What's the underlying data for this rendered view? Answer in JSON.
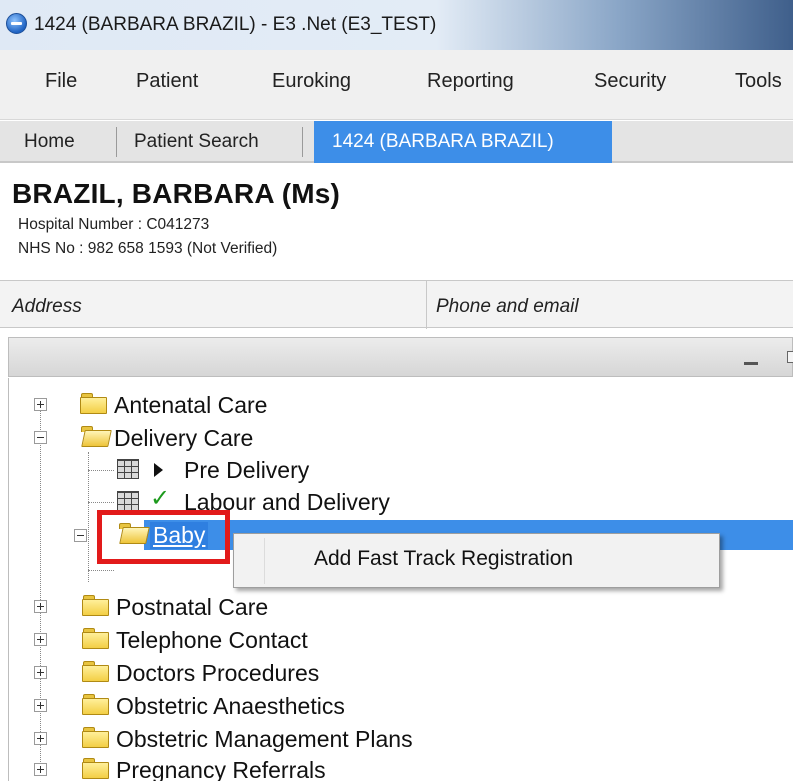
{
  "window": {
    "title": "1424 (BARBARA BRAZIL) - E3 .Net (E3_TEST)",
    "icon": "app-icon"
  },
  "menubar": {
    "items": [
      {
        "label": "File"
      },
      {
        "label": "Patient"
      },
      {
        "label": "Euroking"
      },
      {
        "label": "Reporting"
      },
      {
        "label": "Security"
      },
      {
        "label": "Tools"
      }
    ]
  },
  "tabs": [
    {
      "label": "Home"
    },
    {
      "label": "Patient Search"
    },
    {
      "label": "1424 (BARBARA BRAZIL)",
      "active": true
    }
  ],
  "patient": {
    "name": "BRAZIL, BARBARA (Ms)",
    "hospital_number": "Hospital Number : C041273",
    "nhs_number": "NHS No : 982 658 1593 (Not Verified)"
  },
  "columns": {
    "address": "Address",
    "phone_email": "Phone and email"
  },
  "tree": {
    "antenatal": "Antenatal Care",
    "delivery": "Delivery Care",
    "pre_delivery": "Pre Delivery",
    "labour": "Labour and Delivery",
    "baby": "Baby",
    "postnatal": "Postnatal Care",
    "telephone": "Telephone Contact",
    "doctors": "Doctors Procedures",
    "anaesthetics": "Obstetric Anaesthetics",
    "management": "Obstetric Management Plans",
    "referrals": "Pregnancy Referrals"
  },
  "context_menu": {
    "items": [
      {
        "label": "Add Fast Track Registration"
      }
    ]
  },
  "colors": {
    "selection": "#3d8ee8",
    "highlight_box": "#e21a1a",
    "check": "#1d9a1d"
  }
}
